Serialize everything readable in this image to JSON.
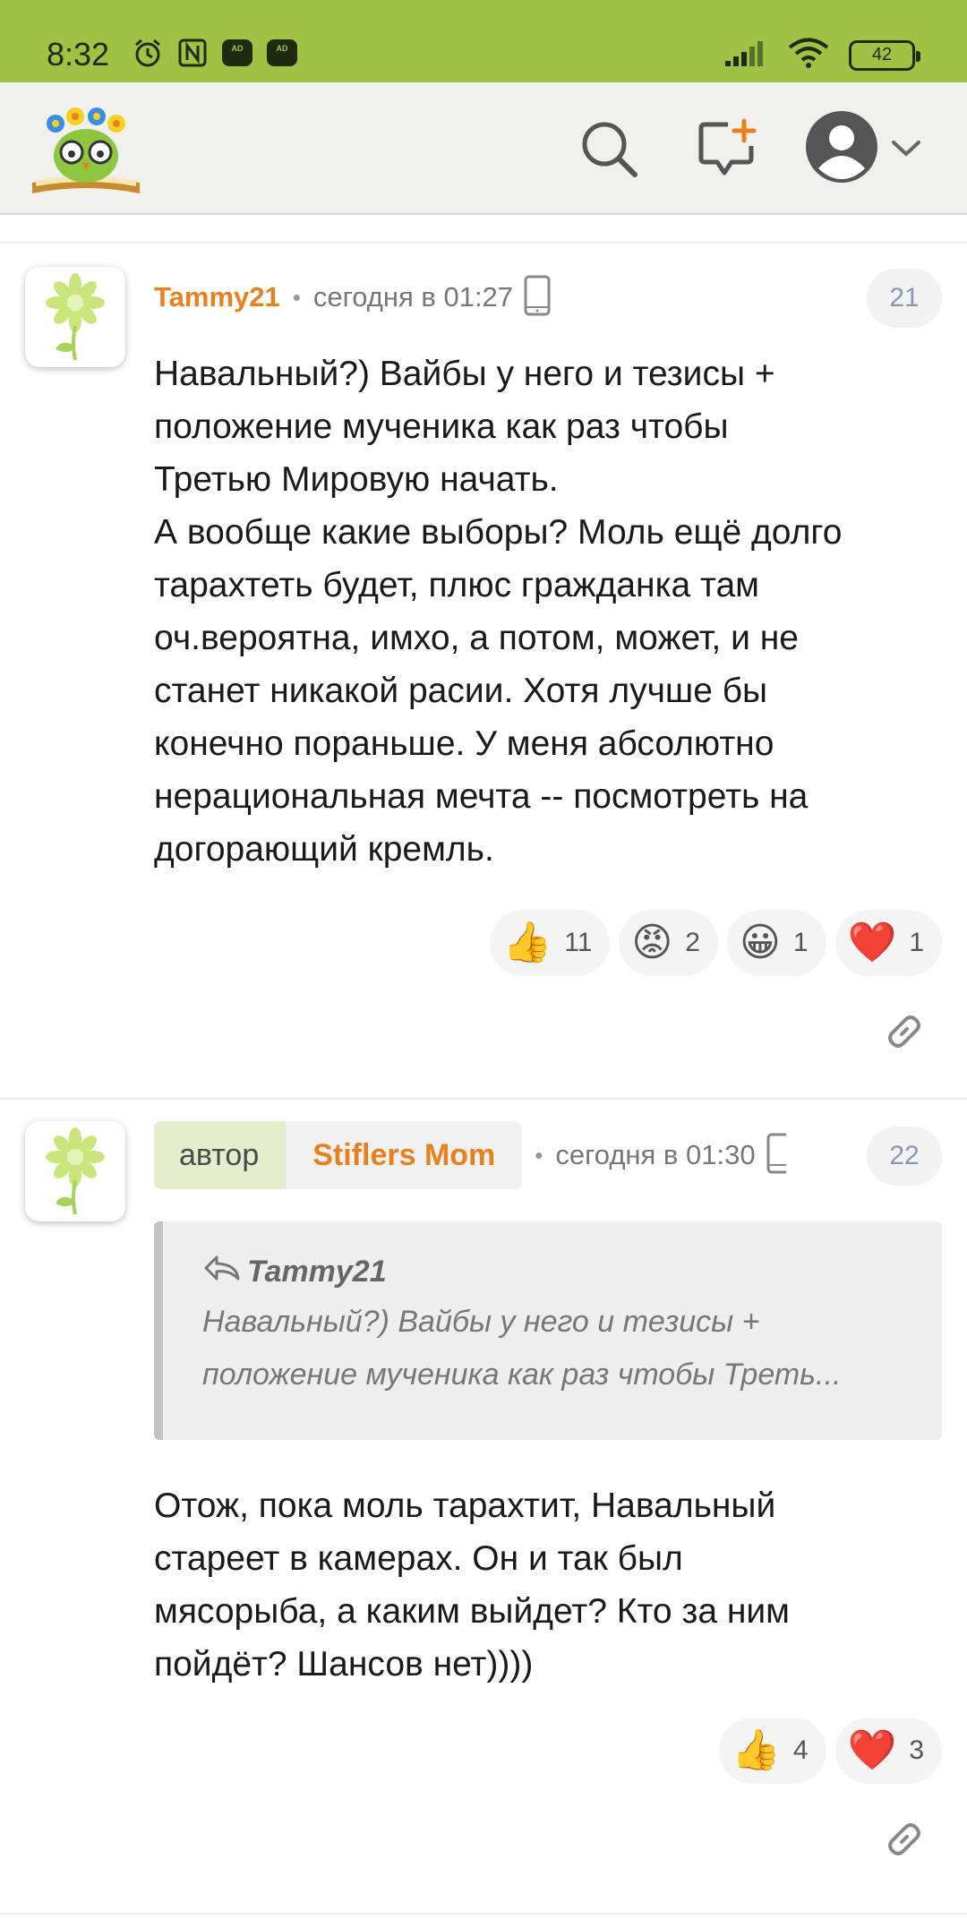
{
  "status_bar": {
    "time": "8:32",
    "battery": "42",
    "icons": [
      "alarm-icon",
      "nfc-icon",
      "adblock-icon",
      "adblock-icon",
      "signal-icon",
      "wifi-icon",
      "battery-icon"
    ],
    "adblock_label": "AD"
  },
  "header": {
    "logo": "owl-logo",
    "icons": [
      "search-icon",
      "new-comment-icon",
      "user-avatar-icon",
      "chevron-down-icon"
    ],
    "accent_color": "#a0c244"
  },
  "comments": [
    {
      "author": "Tammy21",
      "time": "сегодня в 01:27",
      "number": "21",
      "text_lines": [
        "Навальный?) Вайбы у него и тезисы +",
        "положение мученика как раз чтобы",
        "Третью Мировую начать.",
        "А вообще какие выборы? Моль ещё долго",
        "тарахтеть будет, плюс гражданка там",
        "оч.вероятна, имхо, а потом, может, и не",
        "станет никакой расии. Хотя лучше бы",
        "конечно пораньше. У меня абсолютно",
        "нерациональная мечта -- посмотреть на",
        "догорающий кремль."
      ],
      "reactions": [
        {
          "emoji": "👍",
          "count": "11"
        },
        {
          "emoji": "😡",
          "count": "2"
        },
        {
          "emoji": "😀",
          "count": "1"
        },
        {
          "emoji": "❤️",
          "count": "1"
        }
      ]
    },
    {
      "role_tag": "автор",
      "author": "Stiflers Mom",
      "time": "сегодня в 01:30",
      "number": "22",
      "quote": {
        "author": "Tammy21",
        "lines": [
          "Навальный?) Вайбы у него и тезисы +",
          "положение мученика как раз чтобы Треть..."
        ]
      },
      "text_lines": [
        "Отож, пока моль тарахтит, Навальный",
        "стареет в камерах. Он и так был",
        "мясорыба, а каким выйдет? Кто за ним",
        "пойдёт? Шансов нет))))"
      ],
      "reactions": [
        {
          "emoji": "👍",
          "count": "4"
        },
        {
          "emoji": "❤️",
          "count": "3"
        }
      ]
    }
  ]
}
